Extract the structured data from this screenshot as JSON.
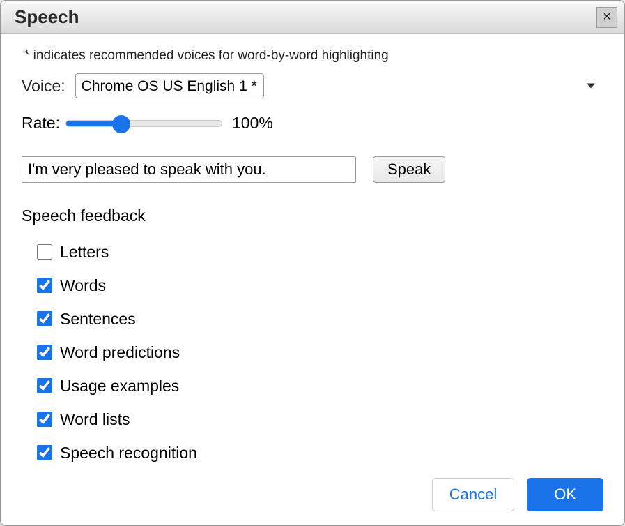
{
  "dialog": {
    "title": "Speech",
    "close_icon": "×"
  },
  "hint": "* indicates recommended voices for word-by-word highlighting",
  "voice": {
    "label": "Voice:",
    "selected": "Chrome OS US English 1 *"
  },
  "rate": {
    "label": "Rate:",
    "value": 100,
    "display": "100%",
    "min": 0,
    "max": 300
  },
  "test": {
    "text": "I'm very pleased to speak with you.",
    "speak_label": "Speak"
  },
  "feedback": {
    "heading": "Speech feedback",
    "items": [
      {
        "label": "Letters",
        "checked": false
      },
      {
        "label": "Words",
        "checked": true
      },
      {
        "label": "Sentences",
        "checked": true
      },
      {
        "label": "Word predictions",
        "checked": true
      },
      {
        "label": "Usage examples",
        "checked": true
      },
      {
        "label": "Word lists",
        "checked": true
      },
      {
        "label": "Speech recognition",
        "checked": true
      }
    ]
  },
  "buttons": {
    "cancel": "Cancel",
    "ok": "OK"
  }
}
